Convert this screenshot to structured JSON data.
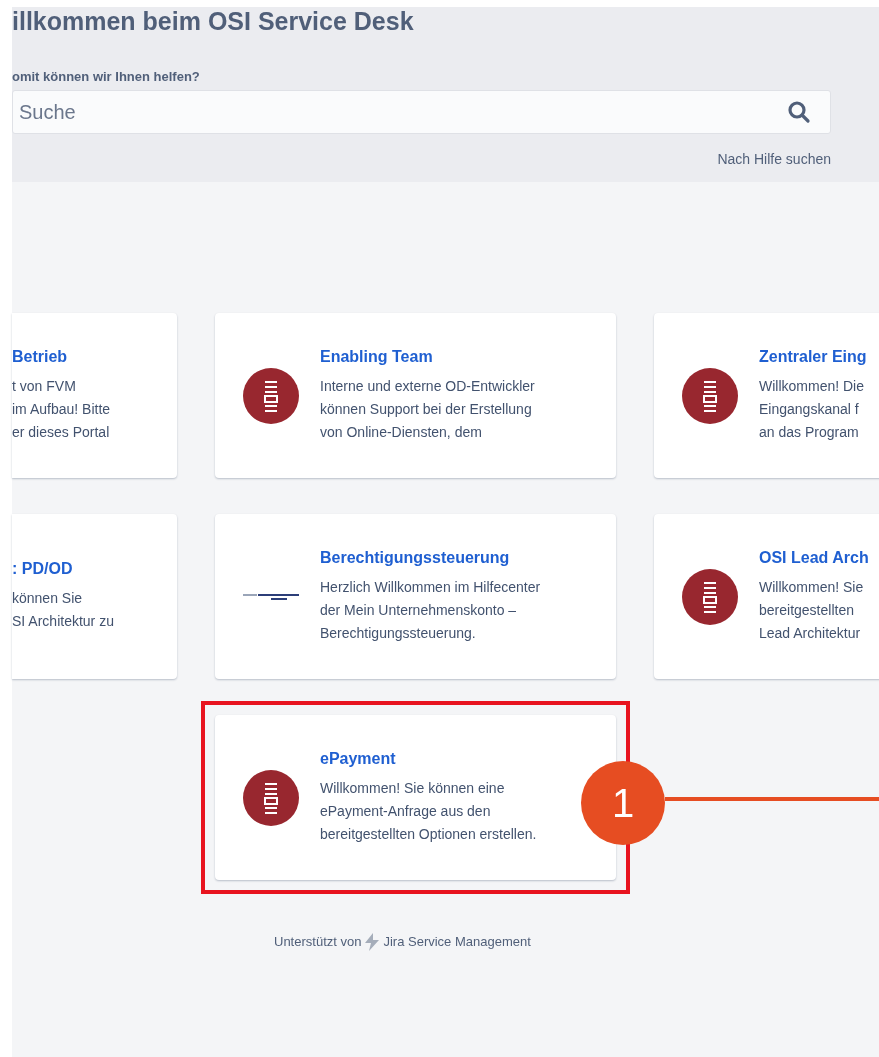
{
  "header": {
    "title": "illkommen beim OSI Service Desk",
    "search_label": "omit können wir Ihnen helfen?",
    "search": {
      "placeholder": "Suche"
    },
    "search_hint": "Nach Hilfe suchen"
  },
  "card_rows": [
    [
      {
        "kind": "plain",
        "title": "Betrieb",
        "description": "t von FVM\nim Aufbau! Bitte\ner dieses Portal",
        "highlighted": false
      },
      {
        "kind": "emblem",
        "title": "Enabling Team",
        "description": "Interne und externe OD-Entwickler\nkönnen Support bei der Erstellung\nvon Online-Diensten, dem",
        "highlighted": false
      },
      {
        "kind": "emblem",
        "title": "Zentraler Eing",
        "description": "Willkommen! Die\nEingangskanal f\nan das Program",
        "highlighted": false
      }
    ],
    [
      {
        "kind": "plain",
        "title": ": PD/OD",
        "description": "können Sie\nSI Architektur zu",
        "highlighted": false
      },
      {
        "kind": "wordmark",
        "title": "Berechtigungssteuerung",
        "description": "Herzlich Willkommen im Hilfecenter\nder Mein Unternehmenskonto –\nBerechtigungssteuerung.",
        "highlighted": false
      },
      {
        "kind": "emblem",
        "title": "OSI Lead Arch",
        "description": "Willkommen! Sie\nbereitgestellten\nLead Architektur",
        "highlighted": false
      }
    ],
    [
      {
        "kind": "emblem",
        "title": "ePayment",
        "description": "Willkommen! Sie können eine\nePayment-Anfrage aus den\nbereitgestellten Optionen erstellen.",
        "highlighted": true,
        "callout": "1"
      }
    ]
  ],
  "footer": {
    "prefix": "Unterstützt von",
    "product": "Jira Service Management"
  }
}
